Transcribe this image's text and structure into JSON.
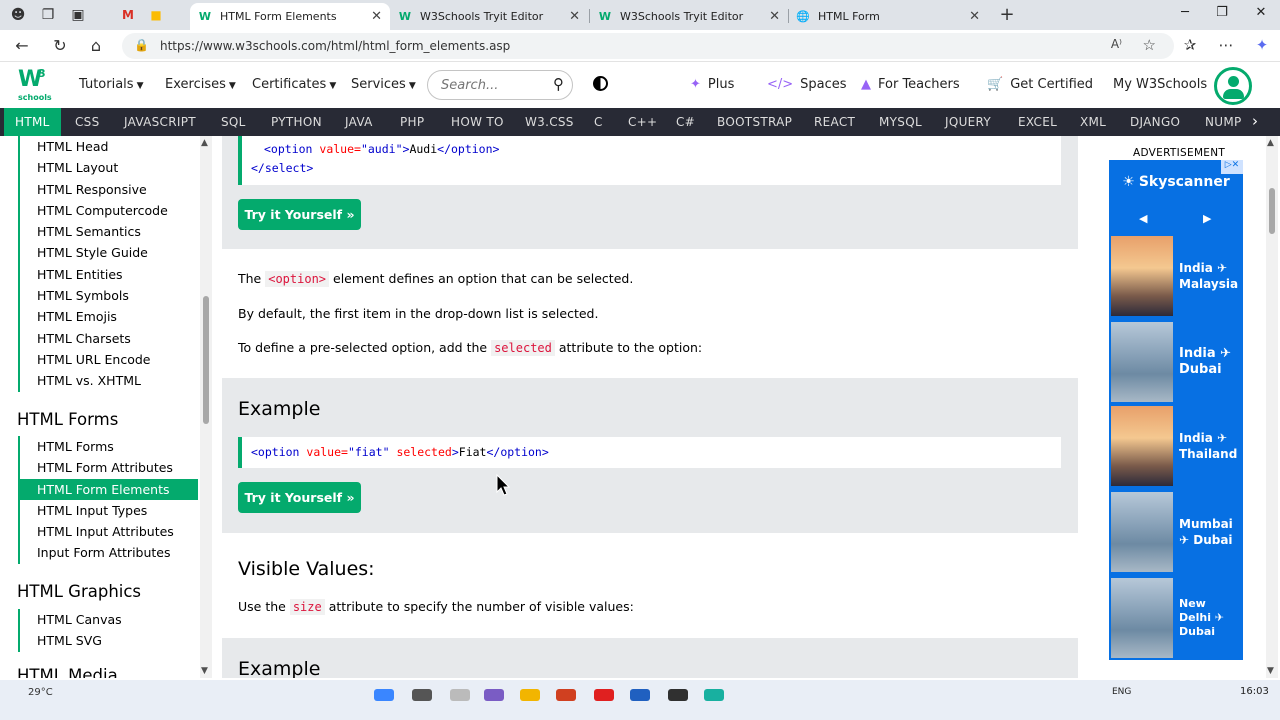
{
  "browser": {
    "tabs": [
      {
        "title": "HTML Form Elements",
        "active": true
      },
      {
        "title": "W3Schools Tryit Editor",
        "active": false
      },
      {
        "title": "W3Schools Tryit Editor",
        "active": false
      },
      {
        "title": "HTML Form",
        "active": false
      }
    ],
    "url": "https://www.w3schools.com/html/html_form_elements.asp",
    "window_icons": [
      "profile-icon",
      "collections-icon",
      "tab-actions-icon"
    ],
    "pinned_icons": [
      "gmail-icon",
      "bookmark-icon"
    ]
  },
  "topnav": {
    "logo_main": "W",
    "logo_sup": "3",
    "logo_sub": "schools",
    "menu": [
      {
        "label": "Tutorials"
      },
      {
        "label": "Exercises"
      },
      {
        "label": "Certificates"
      },
      {
        "label": "Services"
      }
    ],
    "search_placeholder": "Search...",
    "right": [
      {
        "label": "Plus",
        "icon": "sparkle-icon"
      },
      {
        "label": "Spaces",
        "icon": "code-icon"
      },
      {
        "label": "For Teachers",
        "icon": "graduation-cap-icon"
      },
      {
        "label": "Get Certified",
        "icon": "cart-icon"
      },
      {
        "label": "My W3Schools",
        "icon": ""
      }
    ]
  },
  "langbar": [
    "HTML",
    "CSS",
    "JAVASCRIPT",
    "SQL",
    "PYTHON",
    "JAVA",
    "PHP",
    "HOW TO",
    "W3.CSS",
    "C",
    "C++",
    "C#",
    "BOOTSTRAP",
    "REACT",
    "MYSQL",
    "JQUERY",
    "EXCEL",
    "XML",
    "DJANGO",
    "NUMP"
  ],
  "sidebar": {
    "group1": [
      "HTML Head",
      "HTML Layout",
      "HTML Responsive",
      "HTML Computercode",
      "HTML Semantics",
      "HTML Style Guide",
      "HTML Entities",
      "HTML Symbols",
      "HTML Emojis",
      "HTML Charsets",
      "HTML URL Encode",
      "HTML vs. XHTML"
    ],
    "heading_forms": "HTML Forms",
    "group2": [
      "HTML Forms",
      "HTML Form Attributes",
      "HTML Form Elements",
      "HTML Input Types",
      "HTML Input Attributes",
      "Input Form Attributes"
    ],
    "active_item": "HTML Form Elements",
    "heading_graphics": "HTML Graphics",
    "group3": [
      "HTML Canvas",
      "HTML SVG"
    ],
    "heading_media": "HTML Media"
  },
  "main": {
    "code1": {
      "line1_tag_open": "<option",
      "line1_attr": "value=",
      "line1_val": "\"audi\"",
      "line1_gt": ">",
      "line1_text": "Audi",
      "line1_close": "</option>",
      "line2": "</select>"
    },
    "try_label": "Try it Yourself »",
    "p1_pre": "The",
    "p1_code": "<option>",
    "p1_post": "element defines an option that can be selected.",
    "p2": "By default, the first item in the drop-down list is selected.",
    "p3_pre": "To define a pre-selected option, add the",
    "p3_code": "selected",
    "p3_post": "attribute to the option:",
    "example_heading": "Example",
    "code2": {
      "tag_open": "<option",
      "attr1": "value=",
      "val1": "\"fiat\"",
      "attr2": "selected",
      "gt": ">",
      "text": "Fiat",
      "close": "</option>"
    },
    "visible_heading": "Visible Values:",
    "p4_pre": "Use the",
    "p4_code": "size",
    "p4_post": "attribute to specify the number of visible values:",
    "example_heading2": "Example"
  },
  "ad": {
    "label": "ADVERTISEMENT",
    "brand": "Skyscanner",
    "cards": [
      {
        "text": "India ✈ Malaysia",
        "image": "sky"
      },
      {
        "text": "India ✈ Dubai",
        "image": "city"
      },
      {
        "text": "India ✈ Thailand",
        "image": "sky"
      },
      {
        "text": "Mumbai ✈ Dubai",
        "image": "city"
      },
      {
        "text": "New Delhi ✈ Dubai",
        "image": "city"
      }
    ]
  },
  "taskbar": {
    "weather": "29°C",
    "lang": "ENG",
    "time": "16:03"
  },
  "colors": {
    "brand_green": "#04aa6d",
    "langbar_bg": "#282a35",
    "example_bg": "#e7e9eb",
    "ad_blue": "#0770e3"
  }
}
